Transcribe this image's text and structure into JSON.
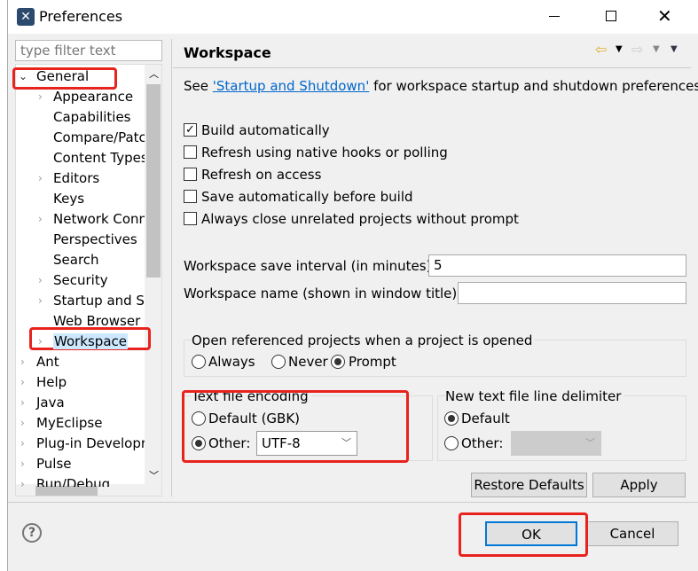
{
  "window": {
    "title": "Preferences",
    "app_icon": "eclipse-icon",
    "minimize": "minimize-icon",
    "maximize": "maximize-icon",
    "close": "close-icon"
  },
  "filter": {
    "placeholder": "type filter text"
  },
  "tree": {
    "general": "General",
    "children": [
      "Appearance",
      "Capabilities",
      "Compare/Patch",
      "Content Types",
      "Editors",
      "Keys",
      "Network Conn",
      "Perspectives",
      "Search",
      "Security",
      "Startup and Sh",
      "Web Browser",
      "Workspace"
    ],
    "children_expandable": [
      true,
      false,
      false,
      false,
      true,
      false,
      true,
      false,
      false,
      true,
      true,
      false,
      true
    ],
    "top": [
      "Ant",
      "Help",
      "Java",
      "MyEclipse",
      "Plug-in Developr",
      "Pulse",
      "Run/Debug"
    ],
    "selected": "Workspace"
  },
  "page": {
    "title": "Workspace",
    "see_prefix": "See ",
    "see_link": "'Startup and Shutdown'",
    "see_suffix": " for workspace startup and shutdown preferences.",
    "checkboxes": [
      {
        "label": "Build automatically",
        "checked": true
      },
      {
        "label": "Refresh using native hooks or polling",
        "checked": false
      },
      {
        "label": "Refresh on access",
        "checked": false
      },
      {
        "label": "Save automatically before build",
        "checked": false
      },
      {
        "label": "Always close unrelated projects without prompt",
        "checked": false
      }
    ],
    "save_interval_label": "Workspace save interval (in minutes):",
    "save_interval_value": "5",
    "name_label": "Workspace name (shown in window title):",
    "name_value": "",
    "open_ref": {
      "label": "Open referenced projects when a project is opened",
      "options": [
        "Always",
        "Never",
        "Prompt"
      ],
      "selected": "Prompt"
    },
    "encoding": {
      "label": "Text file encoding",
      "default_label": "Default (GBK)",
      "other_label": "Other:",
      "selected": "Other",
      "value": "UTF-8"
    },
    "delimiter": {
      "label": "New text file line delimiter",
      "default_label": "Default",
      "other_label": "Other:",
      "selected": "Default",
      "value": ""
    },
    "restore_defaults": "Restore Defaults",
    "apply": "Apply"
  },
  "footer": {
    "help_icon": "help-icon",
    "ok": "OK",
    "cancel": "Cancel"
  },
  "colors": {
    "highlight": "#e8231e",
    "link": "#0066cc",
    "selection": "#cce8ff"
  }
}
